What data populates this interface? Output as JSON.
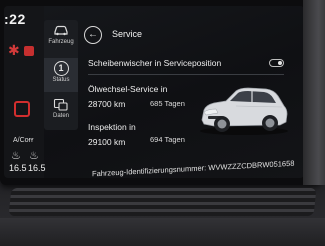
{
  "status_strip": {
    "time": ":22",
    "ac_label": "A/Cᴏғғ",
    "temp_left": "16.5",
    "temp_right": "16.5"
  },
  "nav": {
    "items": [
      {
        "label": "Fahrzeug",
        "icon": "car-icon"
      },
      {
        "label": "Status",
        "icon": "info-icon",
        "active": true
      },
      {
        "label": "Daten",
        "icon": "data-icon"
      }
    ]
  },
  "header": {
    "title": "Service"
  },
  "wiper": {
    "label": "Scheibenwischer in Serviceposition",
    "toggle_on": false
  },
  "oil_service": {
    "title": "Ölwechsel-Service in",
    "km": "28700 km",
    "days": "685 Tagen"
  },
  "inspection": {
    "title": "Inspektion in",
    "km": "29100 km",
    "days": "694 Tagen"
  },
  "vin_line": "Fahrzeug-Identifizierungsnummer: WVWZZZCDBRW051658",
  "colors": {
    "accent_red": "#d23a3a",
    "screen_bg": "#0f1013",
    "text": "#ededed"
  }
}
